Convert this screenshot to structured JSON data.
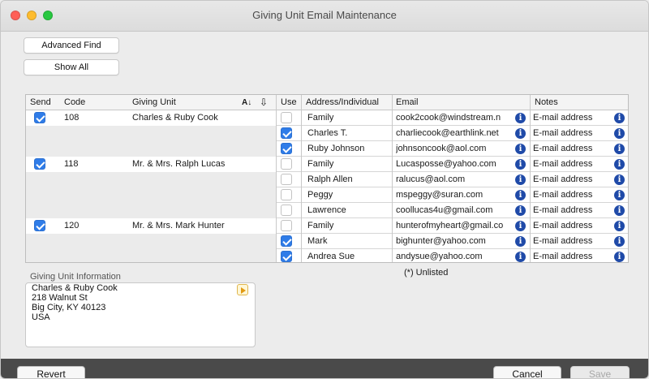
{
  "window": {
    "title": "Giving Unit Email Maintenance"
  },
  "colors": {
    "close": "#ff5f57",
    "minimize": "#febc2e",
    "zoom": "#28c840",
    "checkbox_on": "#2f7ce8",
    "info_icon": "#1f4aa8"
  },
  "toolbar": {
    "advanced_find": "Advanced Find",
    "show_all": "Show All"
  },
  "table": {
    "columns": {
      "send": "Send",
      "code": "Code",
      "giving_unit": "Giving Unit",
      "use": "Use",
      "address": "Address/Individual",
      "email": "Email",
      "notes": "Notes"
    },
    "rows": [
      {
        "send": true,
        "code": "108",
        "unit": "Charles & Ruby Cook",
        "use": false,
        "addr": "Family",
        "email": "cook2cook@windstream.n",
        "notes": "E-mail address"
      },
      {
        "send": null,
        "code": "",
        "unit": "",
        "use": true,
        "addr": "Charles T.",
        "email": "charliecook@earthlink.net",
        "notes": "E-mail address"
      },
      {
        "send": null,
        "code": "",
        "unit": "",
        "use": true,
        "addr": "Ruby Johnson",
        "email": "johnsoncook@aol.com",
        "notes": "E-mail address"
      },
      {
        "send": true,
        "code": "118",
        "unit": "Mr. & Mrs. Ralph Lucas",
        "use": false,
        "addr": "Family",
        "email": "Lucasposse@yahoo.com",
        "notes": "E-mail address"
      },
      {
        "send": null,
        "code": "",
        "unit": "",
        "use": false,
        "addr": "Ralph Allen",
        "email": "ralucus@aol.com",
        "notes": "E-mail address"
      },
      {
        "send": null,
        "code": "",
        "unit": "",
        "use": false,
        "addr": "Peggy",
        "email": "mspeggy@suran.com",
        "notes": "E-mail address"
      },
      {
        "send": null,
        "code": "",
        "unit": "",
        "use": false,
        "addr": "Lawrence",
        "email": "coollucas4u@gmail.com",
        "notes": "E-mail address"
      },
      {
        "send": true,
        "code": "120",
        "unit": "Mr. & Mrs. Mark Hunter",
        "use": false,
        "addr": "Family",
        "email": "hunterofmyheart@gmail.co",
        "notes": "E-mail address"
      },
      {
        "send": null,
        "code": "",
        "unit": "",
        "use": true,
        "addr": "Mark",
        "email": "bighunter@yahoo.com",
        "notes": "E-mail address"
      },
      {
        "send": null,
        "code": "",
        "unit": "",
        "use": true,
        "addr": "Andrea Sue",
        "email": "andysue@yahoo.com",
        "notes": "E-mail address"
      }
    ]
  },
  "unlisted_note": "(*) Unlisted",
  "giving_unit_info": {
    "label": "Giving Unit Information",
    "lines": [
      "Charles & Ruby Cook",
      "218 Walnut St",
      "Big City, KY 40123",
      "USA"
    ]
  },
  "footer": {
    "revert": "Revert",
    "cancel": "Cancel",
    "save": "Save"
  }
}
